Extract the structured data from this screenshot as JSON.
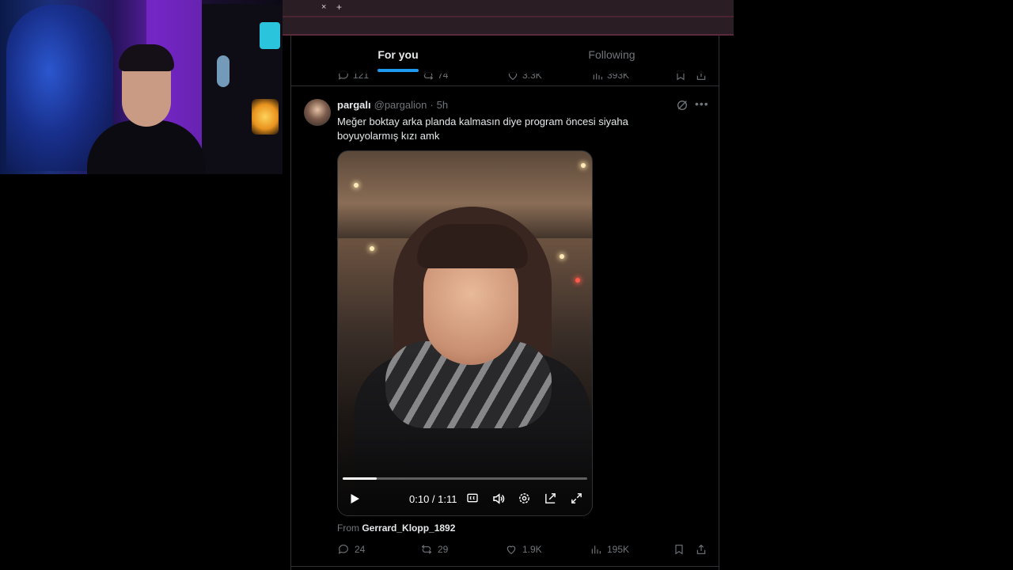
{
  "browser": {
    "tab_close": "×",
    "new_tab": "+"
  },
  "feed": {
    "tabs": [
      {
        "label": "For you",
        "active": true
      },
      {
        "label": "Following",
        "active": false
      }
    ],
    "previous_post_actions": {
      "replies": "121",
      "reposts": "74",
      "likes": "3.3K",
      "views": "393K"
    },
    "post": {
      "display_name": "pargalı",
      "handle": "@pargalion",
      "separator": "·",
      "time": "5h",
      "text": "Meğer boktay arka planda kalmasın diye program öncesi siyaha boyuyolarmış kızı amk",
      "video": {
        "time_readout": "0:10 / 1:11",
        "progress_fraction": 0.14
      },
      "from_label": "From",
      "from_user": "Gerrard_Klopp_1892",
      "actions": {
        "replies": "24",
        "reposts": "29",
        "likes": "1.9K",
        "views": "195K"
      }
    }
  },
  "colors": {
    "accent": "#1d9bf0",
    "text_primary": "#e7e9ea",
    "text_secondary": "#71767b",
    "border": "#2f3336"
  }
}
